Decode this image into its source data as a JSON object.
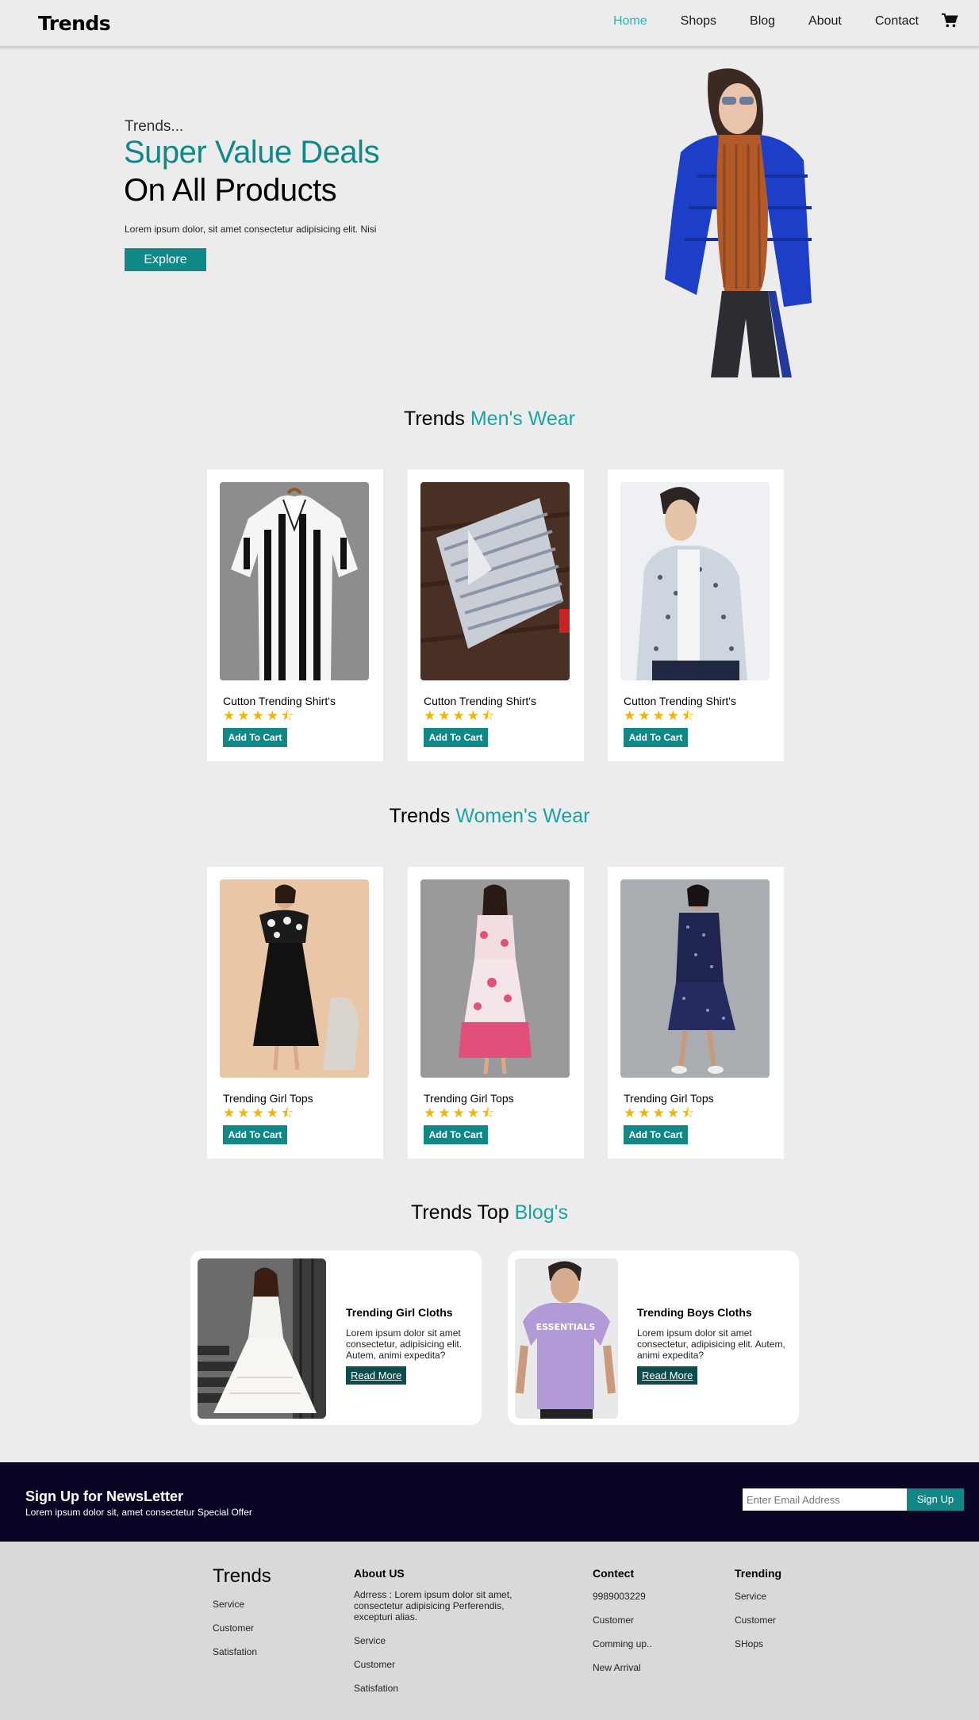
{
  "colors": {
    "accent": "#108888",
    "accent_light": "#1aa3a3",
    "nav_active": "#2bb6b6",
    "star": "#f5b400",
    "newsletter_bg": "#0b0425",
    "footer_bg": "#d9d9d9"
  },
  "nav": {
    "logo": "Trends",
    "links": [
      {
        "label": "Home",
        "active": true
      },
      {
        "label": "Shops"
      },
      {
        "label": "Blog"
      },
      {
        "label": "About"
      },
      {
        "label": "Contact"
      }
    ],
    "cart_icon": "cart-icon"
  },
  "hero": {
    "eyebrow": "Trends...",
    "title_line1": "Super Value Deals",
    "title_line2": "On All Products",
    "text": "Lorem ipsum dolor, sit amet consectetur adipisicing elit. Nisi",
    "button": "Explore"
  },
  "mens": {
    "title_prefix": "Trends",
    "title_accent": "Men's Wear",
    "products": [
      {
        "name": "Cutton Trending Shirt's",
        "rating": 4.5,
        "button": "Add To Cart"
      },
      {
        "name": "Cutton Trending Shirt's",
        "rating": 4.5,
        "button": "Add To Cart"
      },
      {
        "name": "Cutton Trending Shirt's",
        "rating": 4.5,
        "button": "Add To Cart"
      }
    ]
  },
  "womens": {
    "title_prefix": "Trends",
    "title_accent": "Women's Wear",
    "products": [
      {
        "name": "Trending Girl Tops",
        "rating": 4.5,
        "button": "Add To Cart"
      },
      {
        "name": "Trending Girl Tops",
        "rating": 4.5,
        "button": "Add To Cart"
      },
      {
        "name": "Trending Girl Tops",
        "rating": 4.5,
        "button": "Add To Cart"
      }
    ]
  },
  "blogs": {
    "title_prefix": "Trends Top",
    "title_accent": "Blog's",
    "items": [
      {
        "title": "Trending Girl Cloths",
        "text": "Lorem ipsum dolor sit amet consectetur, adipisicing elit. Autem, animi expedita?",
        "button": "Read More"
      },
      {
        "title": "Trending Boys Cloths",
        "text": "Lorem ipsum dolor sit amet consectetur, adipisicing elit. Autem, animi expedita?",
        "button": "Read More"
      }
    ]
  },
  "newsletter": {
    "title": "Sign Up for NewsLetter",
    "subtitle": "Lorem ipsum dolor sit, amet consectetur Special Offer",
    "placeholder": "Enter Email Address",
    "button": "Sign Up"
  },
  "footer": {
    "brand": {
      "name": "Trends",
      "items": [
        "Service",
        "Customer",
        "Satisfation"
      ]
    },
    "about": {
      "heading": "About US",
      "address": "Adrress : Lorem ipsum dolor sit amet, consectetur adipisicing Perferendis, excepturi alias.",
      "items": [
        "Service",
        "Customer",
        "Satisfation"
      ]
    },
    "contact": {
      "heading": "Contect",
      "items": [
        "9989003229",
        "Customer",
        "Comming up..",
        "New Arrival"
      ]
    },
    "trending": {
      "heading": "Trending",
      "items": [
        "Service",
        "Customer",
        "SHops"
      ]
    }
  }
}
